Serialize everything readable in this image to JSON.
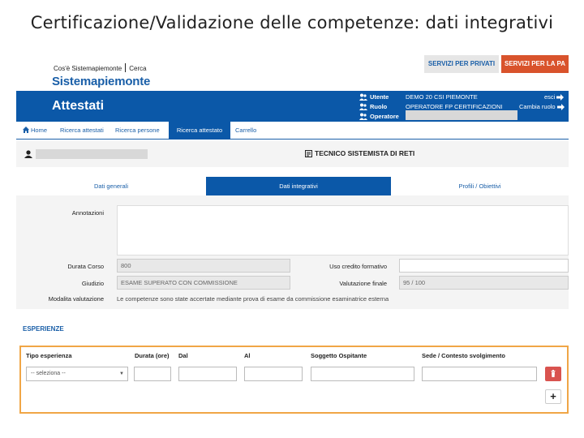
{
  "slide_title": "Certificazione/Validazione delle competenze: dati integrativi",
  "header": {
    "links": [
      "Cos'è Sistemapiemonte",
      "Cerca"
    ],
    "brand": "Sistemapiemonte",
    "svc_private": "SERVIZI PER PRIVATI",
    "svc_pa": "SERVIZI PER LA PA"
  },
  "appbar": {
    "title": "Attestati",
    "utente_label": "Utente",
    "utente_value": "DEMO 20 CSI PIEMONTE",
    "ruolo_label": "Ruolo",
    "ruolo_value": "OPERATORE FP CERTIFICAZIONI",
    "operatore_label": "Operatore",
    "esci": "esci",
    "cambia_ruolo": "Cambia ruolo"
  },
  "nav": {
    "items": [
      "Home",
      "Ricerca attestati",
      "Ricerca persone",
      "Ricerca attestato",
      "Carrello"
    ]
  },
  "student": {
    "course": "TECNICO SISTEMISTA DI RETI"
  },
  "tabs": [
    "Dati generali",
    "Dati integrativi",
    "Profili / Obiettivi"
  ],
  "form": {
    "annotazioni_label": "Annotazioni",
    "durata_label": "Durata Corso",
    "durata_value": "800",
    "credito_label": "Uso credito formativo",
    "giudizio_label": "Giudizio",
    "giudizio_value": "ESAME SUPERATO CON COMMISSIONE",
    "valutazione_label": "Valutazione finale",
    "valutazione_value": "95 / 100",
    "modalita_label": "Modalita valutazione",
    "modalita_value": "Le competenze sono state accertate mediante prova di esame da commissione esaminatrice esterna"
  },
  "esperienze": {
    "title": "ESPERIENZE",
    "headers": [
      "Tipo esperienza",
      "Durata (ore)",
      "Dal",
      "Al",
      "Soggetto Ospitante",
      "Sede / Contesto svolgimento"
    ],
    "select_placeholder": "-- seleziona --",
    "add_label": "+"
  },
  "colors": {
    "primary_blue": "#0b58a8",
    "pa_orange": "#d9532c",
    "highlight": "#f0a646",
    "delete_red": "#d9534f"
  }
}
